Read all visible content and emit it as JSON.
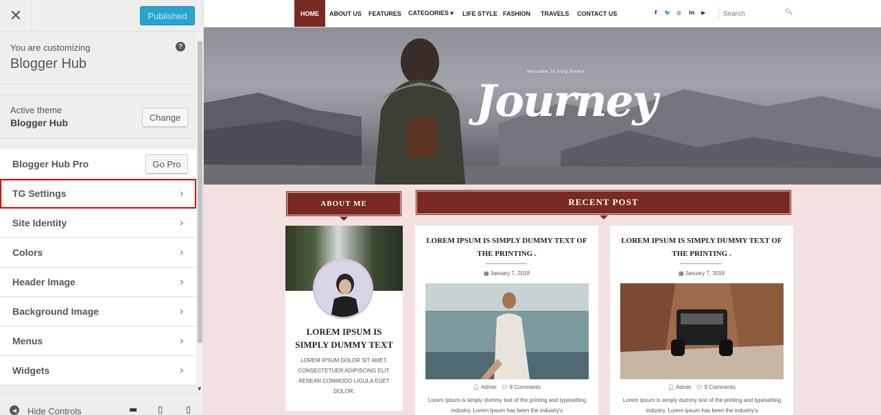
{
  "sidebar": {
    "close_symbol": "✕",
    "publish_label": "Published",
    "info_label": "You are customizing",
    "site_name": "Blogger Hub",
    "help_symbol": "?",
    "active_theme_label": "Active theme",
    "active_theme_name": "Blogger Hub",
    "change_label": "Change",
    "pro_label": "Blogger Hub Pro",
    "go_pro_label": "Go Pro",
    "items": [
      {
        "label": "TG Settings"
      },
      {
        "label": "Site Identity"
      },
      {
        "label": "Colors"
      },
      {
        "label": "Header Image"
      },
      {
        "label": "Background Image"
      },
      {
        "label": "Menus"
      },
      {
        "label": "Widgets"
      }
    ],
    "hide_controls_label": "Hide Controls",
    "highlight_color": "#e00000",
    "accent_color": "#27a5ce"
  },
  "preview": {
    "nav": [
      {
        "label": "HOME"
      },
      {
        "label": "ABOUT US"
      },
      {
        "label": "FEATURES"
      },
      {
        "label": "CATEGORIES ▾"
      },
      {
        "label": "LIFE STYLE"
      },
      {
        "label": "FASHION"
      },
      {
        "label": "TRAVELS"
      },
      {
        "label": "CONTACT US"
      }
    ],
    "social_icons": [
      "facebook-icon",
      "twitter-icon",
      "instagram-icon",
      "linkedin-icon",
      "youtube-icon"
    ],
    "search_placeholder": "Search",
    "hero": {
      "small_text": "Welcome to blog theme",
      "logo_text": "Journey"
    },
    "about": {
      "heading": "ABOUT ME",
      "title": "LOREM IPSUM IS SIMPLY DUMMY TEXT",
      "text": "LOREM IPSUM DOLOR SIT AMET, CONSECTETUER ADIPISCING ELIT. AENEAN COMMODO LIGULA EGET DOLOR."
    },
    "recent": {
      "heading": "RECENT POST",
      "posts": [
        {
          "title": "LOREM IPSUM IS SIMPLY DUMMY TEXT OF THE PRINTING .",
          "date": "January 7, 2018",
          "author": "Admin",
          "comments": "9 Comments",
          "excerpt": "Lorem Ipsum is simply dummy text of the printing and typesetting industry. Lorem Ipsum has been the industry's"
        },
        {
          "title": "LOREM IPSUM IS SIMPLY DUMMY TEXT OF THE PRINTING .",
          "date": "January 7, 2018",
          "author": "Admin",
          "comments": "9 Comments",
          "excerpt": "Lorem Ipsum is simply dummy text of the printing and typesetting industry. Lorem Ipsum has been the industry's"
        }
      ]
    },
    "brand_color": "#7a2a22",
    "background_color": "#f3e1e1"
  }
}
